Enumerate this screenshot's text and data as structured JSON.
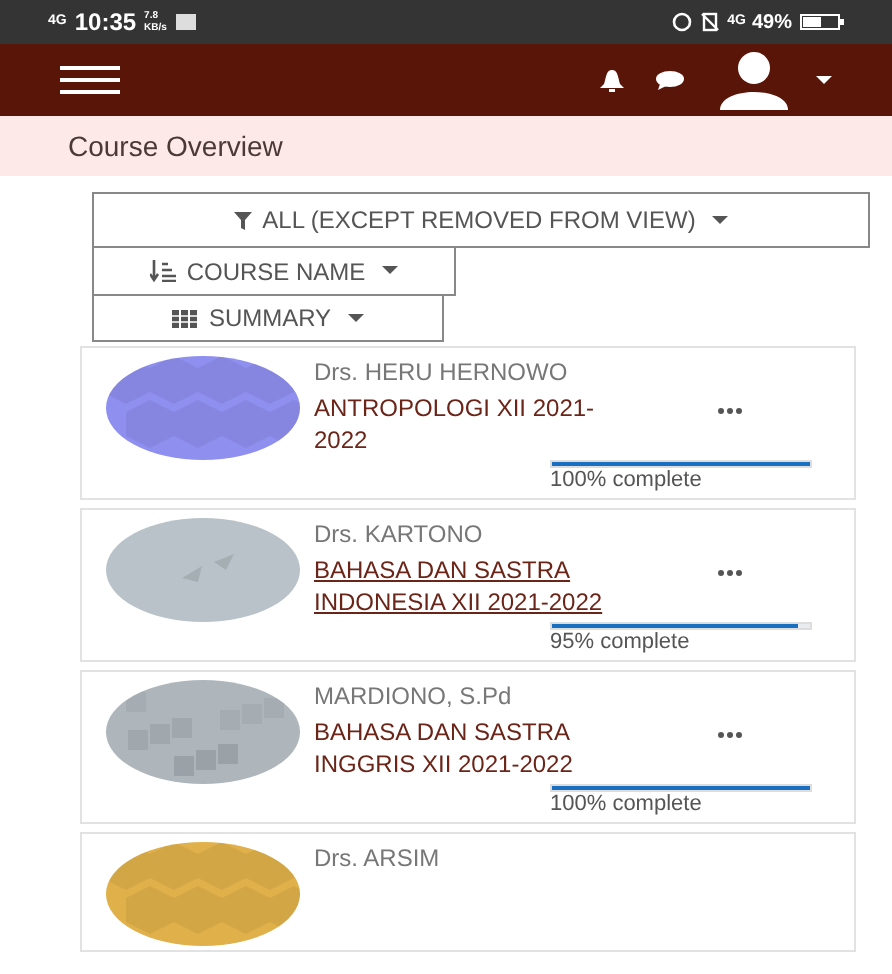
{
  "status_bar": {
    "network_left": "4G",
    "time": "10:35",
    "speed": "7.8 KB/s",
    "network_right": "4G",
    "battery": "49%"
  },
  "header": {
    "title": "Course Overview"
  },
  "filters": [
    {
      "kind": "filter",
      "label": "ALL (EXCEPT REMOVED FROM VIEW)"
    },
    {
      "kind": "sort",
      "label": "COURSE NAME"
    },
    {
      "kind": "view",
      "label": "SUMMARY"
    }
  ],
  "courses": [
    {
      "teacher": "Drs. HERU HERNOWO",
      "name": "ANTROPOLOGI XII 2021-2022",
      "focused": false,
      "level": 1,
      "progress": "100% complete"
    },
    {
      "teacher": "Drs. KARTONO",
      "name": "BAHASA DAN SASTRA INDONESIA XII 2021-2022",
      "focused": true,
      "level": 0.95,
      "progress": "95% complete"
    },
    {
      "teacher": "MARDIONO, S.Pd",
      "name": "BAHASA DAN SASTRA INGGRIS XII 2021-2022",
      "focused": false,
      "level": 1,
      "progress": "100% complete"
    },
    {
      "teacher": "Drs. ARSIM"
    }
  ]
}
